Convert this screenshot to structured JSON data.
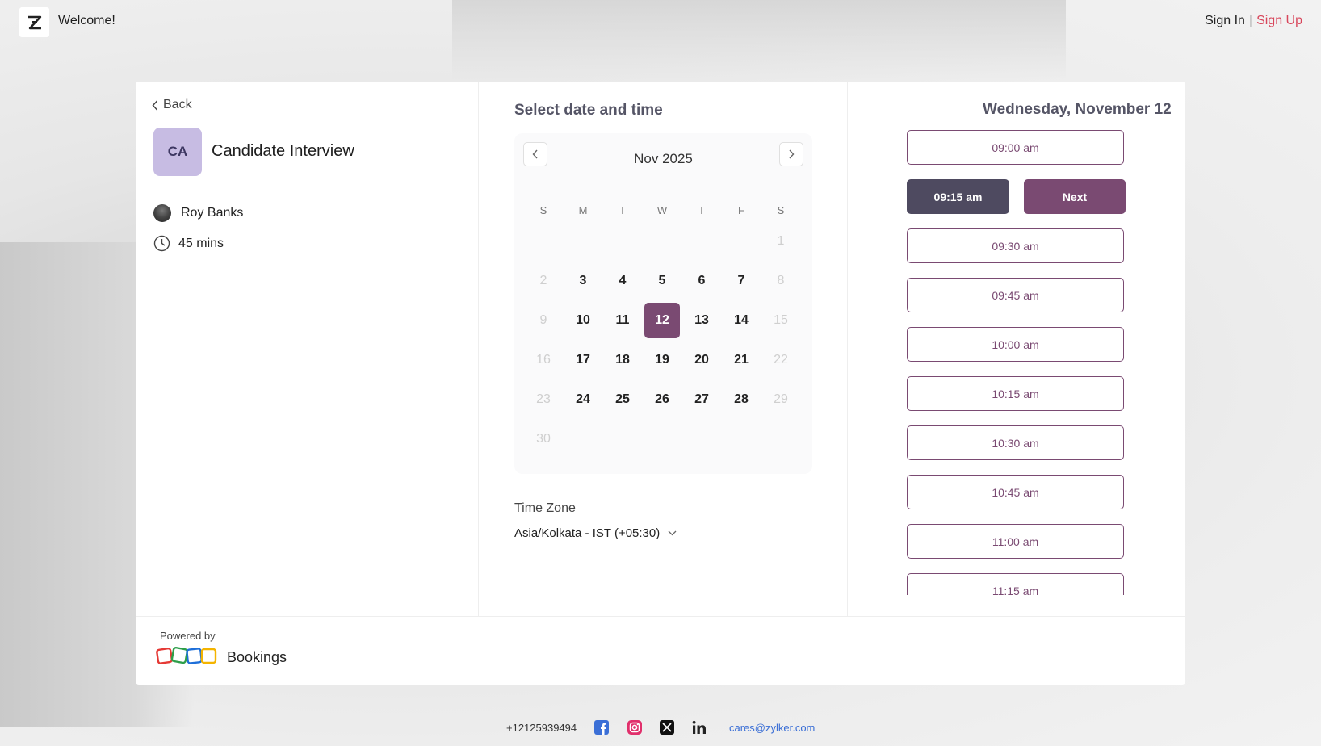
{
  "header": {
    "welcome": "Welcome!",
    "sign_in": "Sign In",
    "separator": "|",
    "sign_up": "Sign Up"
  },
  "event": {
    "back_label": "Back",
    "avatar_initials": "CA",
    "title": "Candidate Interview",
    "host": "Roy Banks",
    "duration": "45 mins"
  },
  "calendar": {
    "heading": "Select date and time",
    "month_label": "Nov 2025",
    "weekdays": [
      "S",
      "M",
      "T",
      "W",
      "T",
      "F",
      "S"
    ],
    "selected_day": "12",
    "weeks": [
      [
        "",
        "",
        "",
        "",
        "",
        "",
        "1"
      ],
      [
        "2",
        "3",
        "4",
        "5",
        "6",
        "7",
        "8"
      ],
      [
        "9",
        "10",
        "11",
        "12",
        "13",
        "14",
        "15"
      ],
      [
        "16",
        "17",
        "18",
        "19",
        "20",
        "21",
        "22"
      ],
      [
        "23",
        "24",
        "25",
        "26",
        "27",
        "28",
        "29"
      ],
      [
        "30",
        "",
        "",
        "",
        "",
        "",
        ""
      ]
    ]
  },
  "timezone": {
    "label": "Time Zone",
    "value": "Asia/Kolkata - IST (+05:30)"
  },
  "slots": {
    "date_heading": "Wednesday, November 12",
    "before": [
      "09:00 am"
    ],
    "selected": "09:15 am",
    "next_label": "Next",
    "after": [
      "09:30 am",
      "09:45 am",
      "10:00 am",
      "10:15 am",
      "10:30 am",
      "10:45 am",
      "11:00 am",
      "11:15 am"
    ]
  },
  "branding": {
    "powered_by": "Powered by",
    "product": "Bookings"
  },
  "footer": {
    "phone": "+12125939494",
    "email": "cares@zylker.com",
    "social_icons": [
      "facebook-icon",
      "instagram-icon",
      "x-icon",
      "linkedin-icon"
    ]
  },
  "colors": {
    "accent": "#7a4a72",
    "selected_slot": "#4e4a60",
    "sign_up": "#d8465b",
    "avatar_bg": "#c7bce3",
    "link": "#3b6fd6"
  }
}
